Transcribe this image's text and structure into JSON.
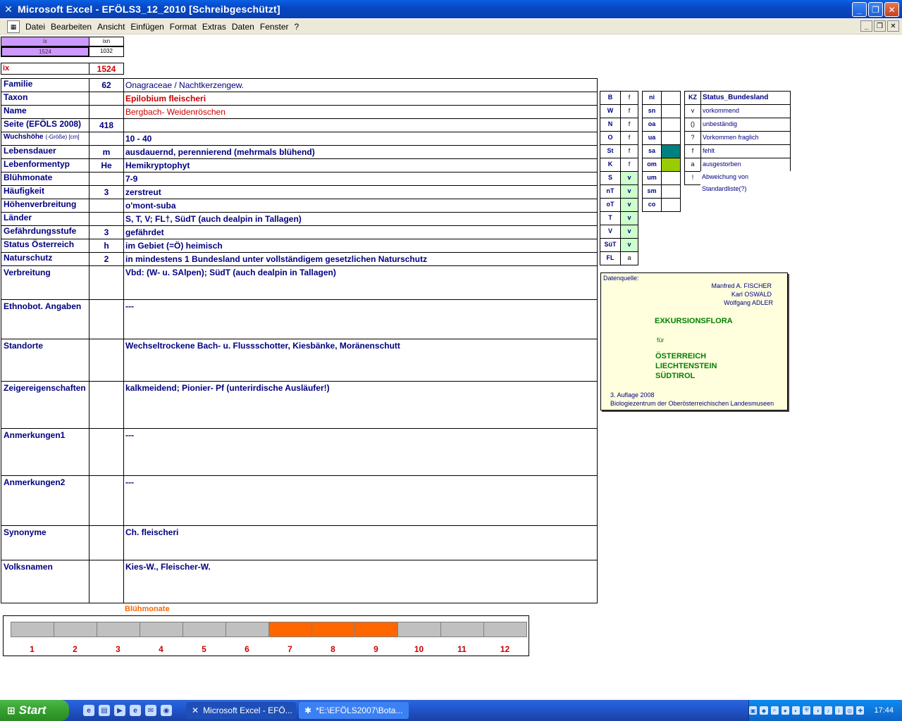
{
  "window": {
    "title": "Microsoft Excel - EFÖLS3_12_2010  [Schreibgeschützt]",
    "app_icon": "excel-icon"
  },
  "menu": [
    "Datei",
    "Bearbeiten",
    "Ansicht",
    "Einfügen",
    "Format",
    "Extras",
    "Daten",
    "Fenster",
    "?"
  ],
  "index_box": {
    "hdr1": "ix",
    "hdr2": "ixn",
    "val1": "1524",
    "val2": "1032",
    "ix_label": "ix",
    "ix_value": "1524"
  },
  "rows": [
    {
      "label": "Familie",
      "code": "62",
      "value": "Onagraceae  /  Nachtkerzengew."
    },
    {
      "label": "Taxon",
      "code": "",
      "value": "Epilobium fleischeri"
    },
    {
      "label": "Name",
      "code": "",
      "value": "Bergbach- Weidenröschen"
    },
    {
      "label": "Seite (EFÖLS 2008)",
      "code": "418",
      "value": ""
    },
    {
      "label": "Wuchshöhe",
      "label_suffix": "(-Größe) [cm]",
      "code": "",
      "value": " 10 - 40"
    },
    {
      "label": "Lebensdauer",
      "code": "m",
      "value": "ausdauernd, perennierend (mehrmals blühend)"
    },
    {
      "label": "Lebenformentyp",
      "code": "He",
      "value": "Hemikryptophyt"
    },
    {
      "label": "Blühmonate",
      "code": "",
      "value": " 7-9"
    },
    {
      "label": "Häufigkeit",
      "code": "3",
      "value": "zerstreut"
    },
    {
      "label": "Höhenverbreitung",
      "code": "",
      "value": "o'mont-suba"
    },
    {
      "label": "Länder",
      "code": "",
      "value": "S, T, V; FL†, SüdT (auch dealpin in Tallagen)"
    },
    {
      "label": "Gefährdungsstufe",
      "code": "3",
      "value": "gefährdet"
    },
    {
      "label": "Status Österreich",
      "code": "h",
      "value": "im Gebiet (=Ö) heimisch"
    },
    {
      "label": "Naturschutz",
      "code": "2",
      "value": "in mindestens 1 Bundesland unter vollständigem gesetzlichen Naturschutz"
    }
  ],
  "big_rows": [
    {
      "label": "Verbreitung",
      "value": "Vbd: (W- u. SAlpen);  SüdT (auch dealpin in Tallagen)"
    },
    {
      "label": "Ethnobot. Angaben",
      "value": "---"
    },
    {
      "label": "Standorte",
      "value": "Wechseltrockene Bach- u. Flussschotter, Kiesbänke, Moränenschutt"
    },
    {
      "label": "Zeigereigenschaften",
      "value": "kalkmeidend; Pionier- Pf (unterirdische Ausläufer!)"
    },
    {
      "label": "Anmerkungen1",
      "value": "---"
    },
    {
      "label": "Anmerkungen2",
      "value": "---"
    },
    {
      "label": "Synonyme",
      "value": "Ch. fleischeri"
    },
    {
      "label": "Volksnamen",
      "value": "Kies-W., Fleischer-W."
    }
  ],
  "bundeslaender": [
    {
      "kz": "B",
      "st": "f"
    },
    {
      "kz": "W",
      "st": "f"
    },
    {
      "kz": "N",
      "st": "f"
    },
    {
      "kz": "O",
      "st": "f"
    },
    {
      "kz": "St",
      "st": "f"
    },
    {
      "kz": "K",
      "st": "f"
    },
    {
      "kz": "S",
      "st": "v"
    },
    {
      "kz": "nT",
      "st": "v"
    },
    {
      "kz": "oT",
      "st": "v"
    },
    {
      "kz": "T",
      "st": "v"
    },
    {
      "kz": "V",
      "st": "v"
    },
    {
      "kz": "SüT",
      "st": "v"
    },
    {
      "kz": "FL",
      "st": "a"
    }
  ],
  "regions": [
    "ni",
    "sn",
    "oa",
    "ua",
    "sa",
    "om",
    "um",
    "sm",
    "co"
  ],
  "legend": {
    "hdr_kz": "KZ",
    "hdr_status": "Status_Bundesland",
    "items": [
      {
        "kz": "v",
        "text": "vorkommend"
      },
      {
        "kz": "()",
        "text": "unbeständig"
      },
      {
        "kz": "?",
        "text": "Vorkommen fraglich"
      },
      {
        "kz": "f",
        "text": "fehlt"
      },
      {
        "kz": "a",
        "text": "ausgestorben"
      },
      {
        "kz": "!",
        "text": "Abweichung von Standardliste(?)"
      }
    ]
  },
  "datenquelle": {
    "label": "Datenquelle:",
    "author1": "Manfred A. FISCHER",
    "author2": "Karl OSWALD",
    "author3": "Wolfgang ADLER",
    "title": "EXKURSIONSFLORA",
    "fuer": "für",
    "land1": "ÖSTERREICH",
    "land2": "LIECHTENSTEIN",
    "land3": "SÜDTIROL",
    "edition": "3. Auflage 2008",
    "publisher": "Biologiezentrum der Oberösterreichischen Landesmuseen"
  },
  "bluehmonate": {
    "title": "Blühmonate",
    "months": [
      "1",
      "2",
      "3",
      "4",
      "5",
      "6",
      "7",
      "8",
      "9",
      "10",
      "11",
      "12"
    ],
    "active": [
      7,
      8,
      9
    ],
    "colors": {
      "active": "#ff6600",
      "inactive": "#c0c0c0"
    }
  },
  "taskbar": {
    "start": "Start",
    "tasks": [
      "Microsoft Excel - EFÖ...",
      "*E:\\EFÖLS2007\\Bota..."
    ],
    "clock": "17:44"
  }
}
